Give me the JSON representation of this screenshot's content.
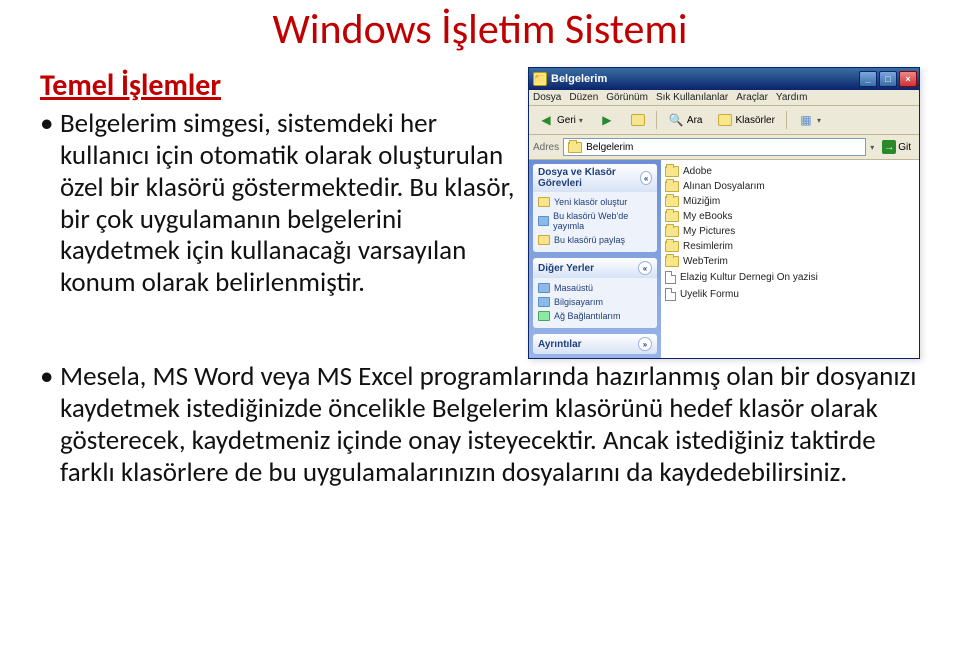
{
  "title": "Windows İşletim Sistemi",
  "subheading": "Temel İşlemler",
  "bullets": [
    "Belgelerim simgesi, sistemdeki her kullanıcı için otomatik olarak oluşturulan özel bir klasörü göstermektedir. Bu klasör, bir çok uygulamanın belgelerini kaydetmek için kullanacağı varsayılan konum olarak belirlenmiştir.",
    "Mesela, MS Word veya MS Excel programlarında hazırlanmış olan bir dosyanızı kaydetmek istediğinizde öncelikle Belgelerim klasörünü hedef klasör olarak gösterecek, kaydetmeniz içinde onay isteyecektir. Ancak istediğiniz taktirde farklı klasörlere de bu uygulamalarınızın dosyalarını da kaydedebilirsiniz."
  ],
  "explorer": {
    "windowTitle": "Belgelerim",
    "menu": [
      "Dosya",
      "Düzen",
      "Görünüm",
      "Sık Kullanılanlar",
      "Araçlar",
      "Yardım"
    ],
    "toolbar": {
      "back": "Geri",
      "search": "Ara",
      "folders": "Klasörler"
    },
    "addressLabel": "Adres",
    "addressValue": "Belgelerim",
    "goLabel": "Git",
    "sidebar": {
      "panel1": {
        "title": "Dosya ve Klasör Görevleri",
        "items": [
          "Yeni klasör oluştur",
          "Bu klasörü Web'de yayımla",
          "Bu klasörü paylaş"
        ]
      },
      "panel2": {
        "title": "Diğer Yerler",
        "items": [
          "Masaüstü",
          "Bilgisayarım",
          "Ağ Bağlantılarım"
        ]
      },
      "panel3": {
        "title": "Ayrıntılar"
      }
    },
    "files": [
      {
        "name": "Adobe",
        "type": "folder"
      },
      {
        "name": "Alınan Dosyalarım",
        "type": "folder"
      },
      {
        "name": "Müziğim",
        "type": "folder"
      },
      {
        "name": "My eBooks",
        "type": "folder"
      },
      {
        "name": "My Pictures",
        "type": "folder"
      },
      {
        "name": "Resimlerim",
        "type": "folder"
      },
      {
        "name": "WebTerim",
        "type": "folder"
      },
      {
        "name": "Elazig Kultur Dernegi On yazisi",
        "type": "file"
      },
      {
        "name": "Uyelik Formu",
        "type": "file"
      }
    ]
  }
}
